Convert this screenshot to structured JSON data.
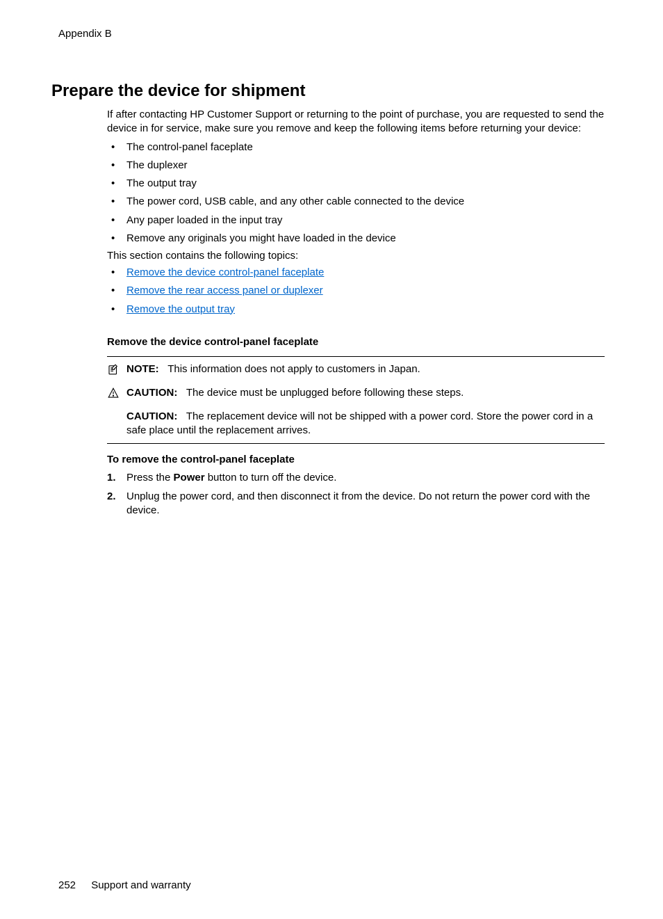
{
  "header": {
    "appendix": "Appendix B"
  },
  "main": {
    "heading": "Prepare the device for shipment",
    "intro": "If after contacting HP Customer Support or returning to the point of purchase, you are requested to send the device in for service, make sure you remove and keep the following items before returning your device:",
    "bullets": [
      "The control-panel faceplate",
      "The duplexer",
      "The output tray",
      "The power cord, USB cable, and any other cable connected to the device",
      "Any paper loaded in the input tray",
      "Remove any originals you might have loaded in the device"
    ],
    "topics_intro": "This section contains the following topics:",
    "topic_links": [
      "Remove the device control-panel faceplate",
      "Remove the rear access panel or duplexer",
      "Remove the output tray"
    ],
    "sub_heading": "Remove the device control-panel faceplate",
    "note": {
      "label": "NOTE:",
      "text": "This information does not apply to customers in Japan."
    },
    "caution1": {
      "label": "CAUTION:",
      "text": "The device must be unplugged before following these steps."
    },
    "caution2": {
      "label": "CAUTION:",
      "text": "The replacement device will not be shipped with a power cord. Store the power cord in a safe place until the replacement arrives."
    },
    "procedure_heading": "To remove the control-panel faceplate",
    "steps": [
      {
        "num": "1.",
        "pre": "Press the ",
        "bold": "Power",
        "post": " button to turn off the device."
      },
      {
        "num": "2.",
        "pre": "Unplug the power cord, and then disconnect it from the device. Do not return the power cord with the device.",
        "bold": "",
        "post": ""
      }
    ]
  },
  "footer": {
    "page_num": "252",
    "section": "Support and warranty"
  }
}
